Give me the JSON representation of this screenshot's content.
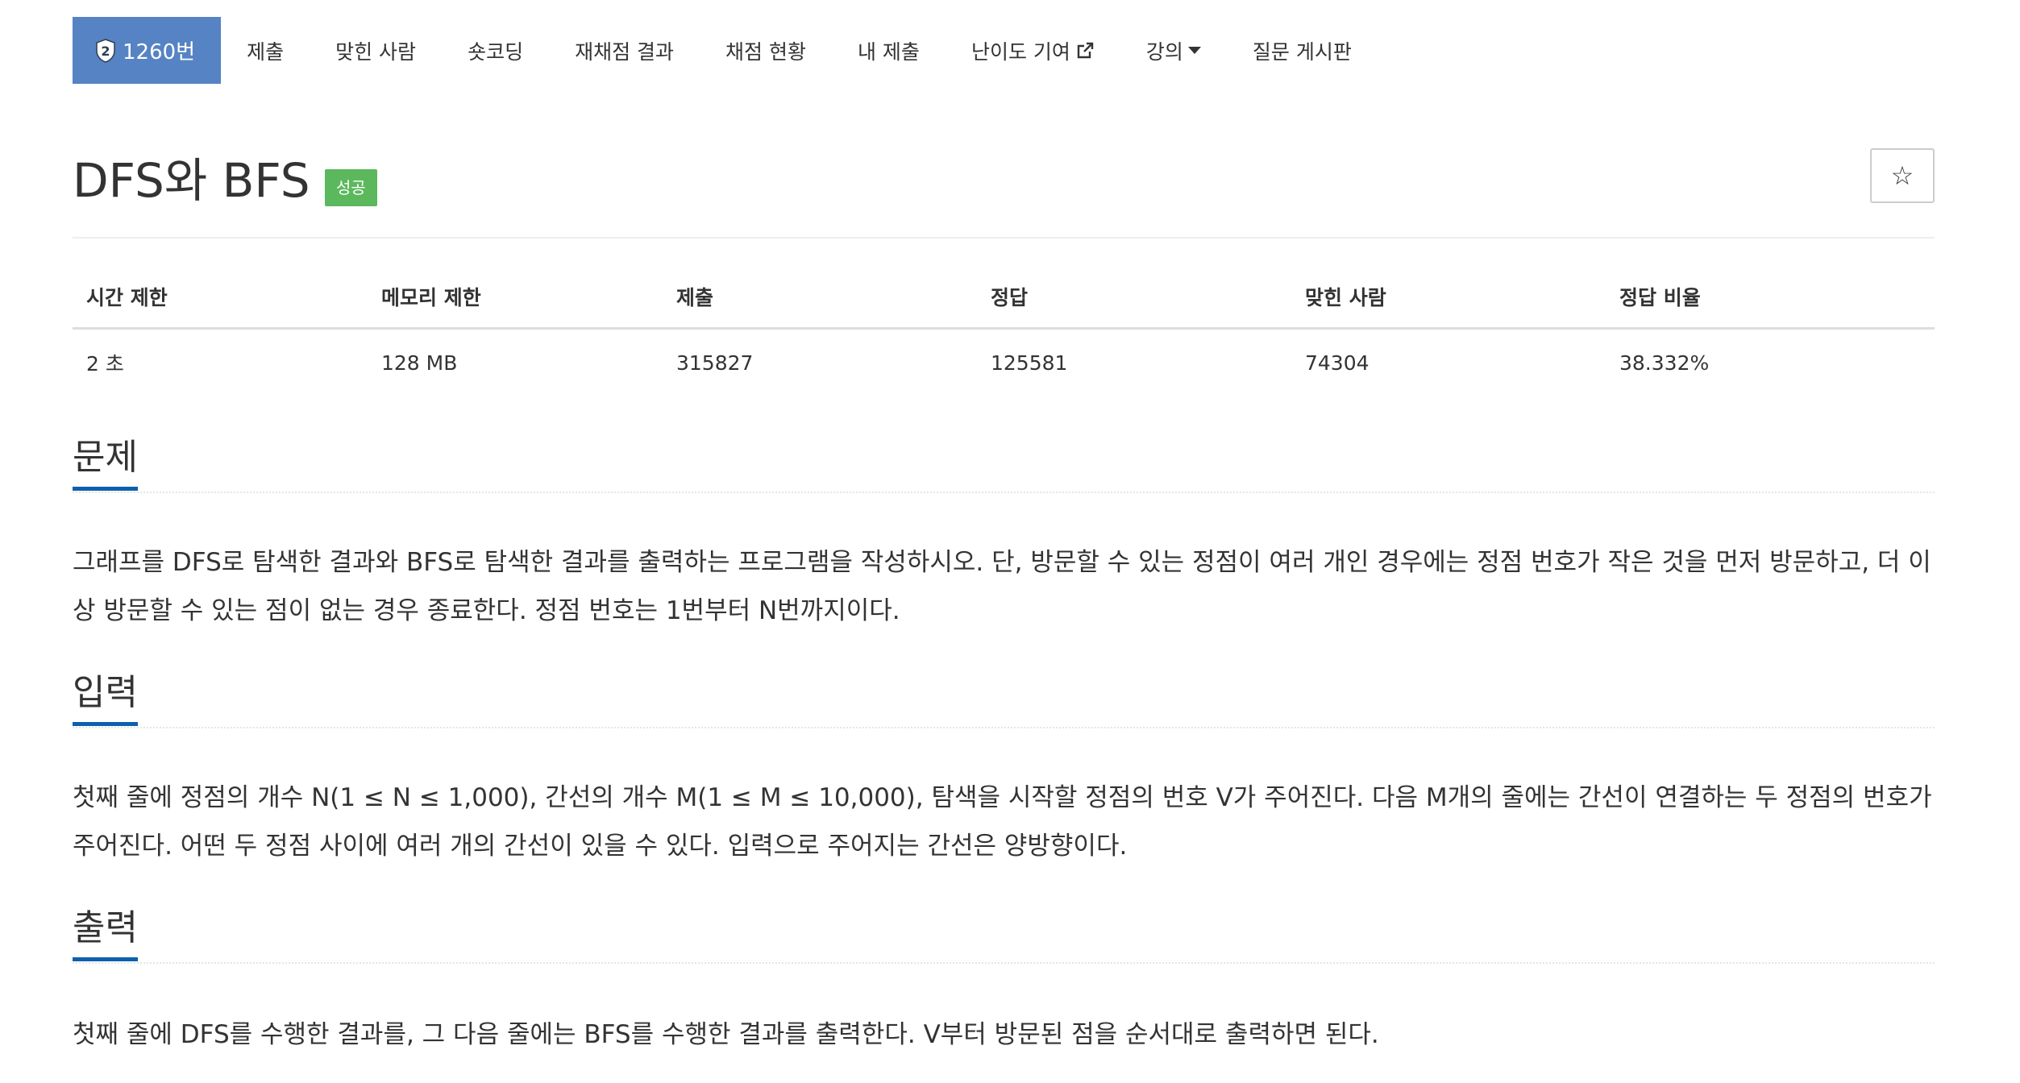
{
  "nav": {
    "problem_number": "1260번",
    "items": [
      "제출",
      "맞힌 사람",
      "숏코딩",
      "재채점 결과",
      "채점 현황",
      "내 제출"
    ],
    "difficulty": "난이도 기여",
    "lecture": "강의",
    "board": "질문 게시판",
    "tier_digit": "2"
  },
  "header": {
    "title": "DFS와 BFS",
    "badge": "성공",
    "star": "☆"
  },
  "stats": {
    "headers": [
      "시간 제한",
      "메모리 제한",
      "제출",
      "정답",
      "맞힌 사람",
      "정답 비율"
    ],
    "values": [
      "2 초",
      "128 MB",
      "315827",
      "125581",
      "74304",
      "38.332%"
    ]
  },
  "sections": {
    "problem": {
      "title": "문제",
      "text": "그래프를 DFS로 탐색한 결과와 BFS로 탐색한 결과를 출력하는 프로그램을 작성하시오. 단, 방문할 수 있는 정점이 여러 개인 경우에는 정점 번호가 작은 것을 먼저 방문하고, 더 이상 방문할 수 있는 점이 없는 경우 종료한다. 정점 번호는 1번부터 N번까지이다."
    },
    "input": {
      "title": "입력",
      "text": "첫째 줄에 정점의 개수 N(1 ≤ N ≤ 1,000), 간선의 개수 M(1 ≤ M ≤ 10,000), 탐색을 시작할 정점의 번호 V가 주어진다. 다음 M개의 줄에는 간선이 연결하는 두 정점의 번호가 주어진다. 어떤 두 정점 사이에 여러 개의 간선이 있을 수 있다. 입력으로 주어지는 간선은 양방향이다."
    },
    "output": {
      "title": "출력",
      "text": "첫째 줄에 DFS를 수행한 결과를, 그 다음 줄에는 BFS를 수행한 결과를 출력한다. V부터 방문된 점을 순서대로 출력하면 된다."
    }
  },
  "colors": {
    "active_tab": "#5683c3",
    "success_badge": "#5cb85c",
    "section_underline": "#0d60ad"
  }
}
